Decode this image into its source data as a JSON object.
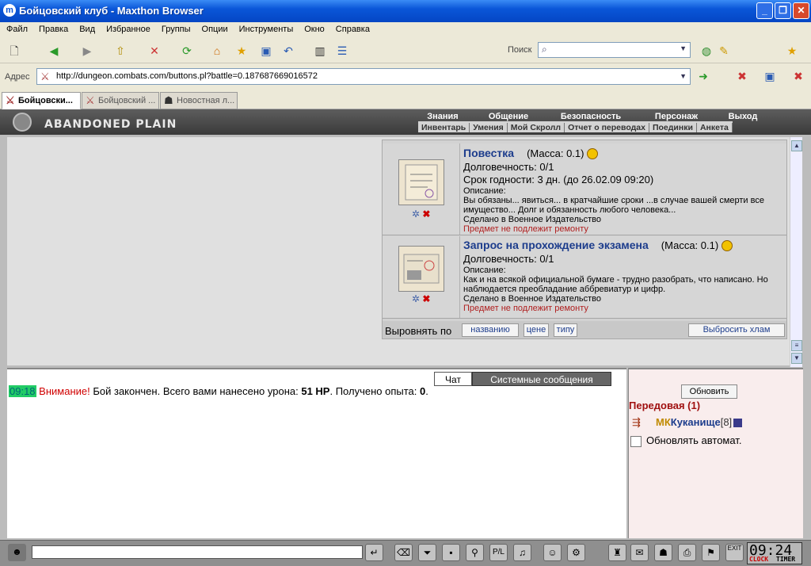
{
  "window": {
    "title": "Бойцовский клуб - Maxthon Browser"
  },
  "menu": [
    "Файл",
    "Правка",
    "Вид",
    "Избранное",
    "Группы",
    "Опции",
    "Инструменты",
    "Окно",
    "Справка"
  ],
  "search": {
    "label": "Поиск"
  },
  "address": {
    "label": "Адрес",
    "url": "http://dungeon.combats.com/buttons.pl?battle=0.187687669016572"
  },
  "tabs": [
    "Бойцовски...",
    "Бойцовский ...",
    "Новостная л..."
  ],
  "game": {
    "logo": "ABANDONED PLAIN",
    "nav_top": [
      "Знания",
      "Общение",
      "Безопасность",
      "Персонаж",
      "Выход"
    ],
    "nav_bottom": [
      "Инвентарь",
      "Умения",
      "Мой Скролл",
      "Отчет о переводах",
      "Поединки",
      "Анкета"
    ],
    "items": [
      {
        "name": "Повестка",
        "mass": "(Масса: 0.1)",
        "durability": "Долговечность: 0/1",
        "expiry": "Срок годности: 3 дн. (до 26.02.09 09:20)",
        "desc_label": "Описание:",
        "desc": "Вы обязаны... явиться... в кратчайшие сроки ...в случае вашей смерти все имущество... Долг и обязанность любого человека...",
        "made": "Сделано в Военное Издательство",
        "repair": "Предмет не подлежит ремонту"
      },
      {
        "name": "Запрос на прохождение экзамена",
        "mass": "(Масса: 0.1)",
        "durability": "Долговечность: 0/1",
        "desc_label": "Описание:",
        "desc": "Как и на всякой официальной бумаге - трудно разобрать, что написано. Но наблюдается преобладание аббревиатур и цифр.",
        "made": "Сделано в Военное Издательство",
        "repair": "Предмет не подлежит ремонту"
      }
    ],
    "sort": {
      "label": "Выровнять по",
      "by_name": "названию",
      "by_price": "цене",
      "by_type": "типу",
      "dump": "Выбросить хлам"
    }
  },
  "chat": {
    "tab_chat": "Чат",
    "tab_system": "Системные сообщения",
    "time": "09:18",
    "warn": "Внимание!",
    "msg_a": " Бой закончен. Всего вами нанесено урона: ",
    "damage": "51 HP",
    "msg_b": ". Получено опыта: ",
    "exp": "0",
    "msg_c": "."
  },
  "panel": {
    "refresh": "Обновить",
    "location": "Передовая (1)",
    "player_badge": "МК",
    "player": "Куканище",
    "player_level": "[8]",
    "auto_refresh": "Обновлять автомат."
  },
  "clock": {
    "time": "09:24",
    "clock_label": "CLOCK",
    "timer_label": "TIMER",
    "exit": "EXIT"
  }
}
